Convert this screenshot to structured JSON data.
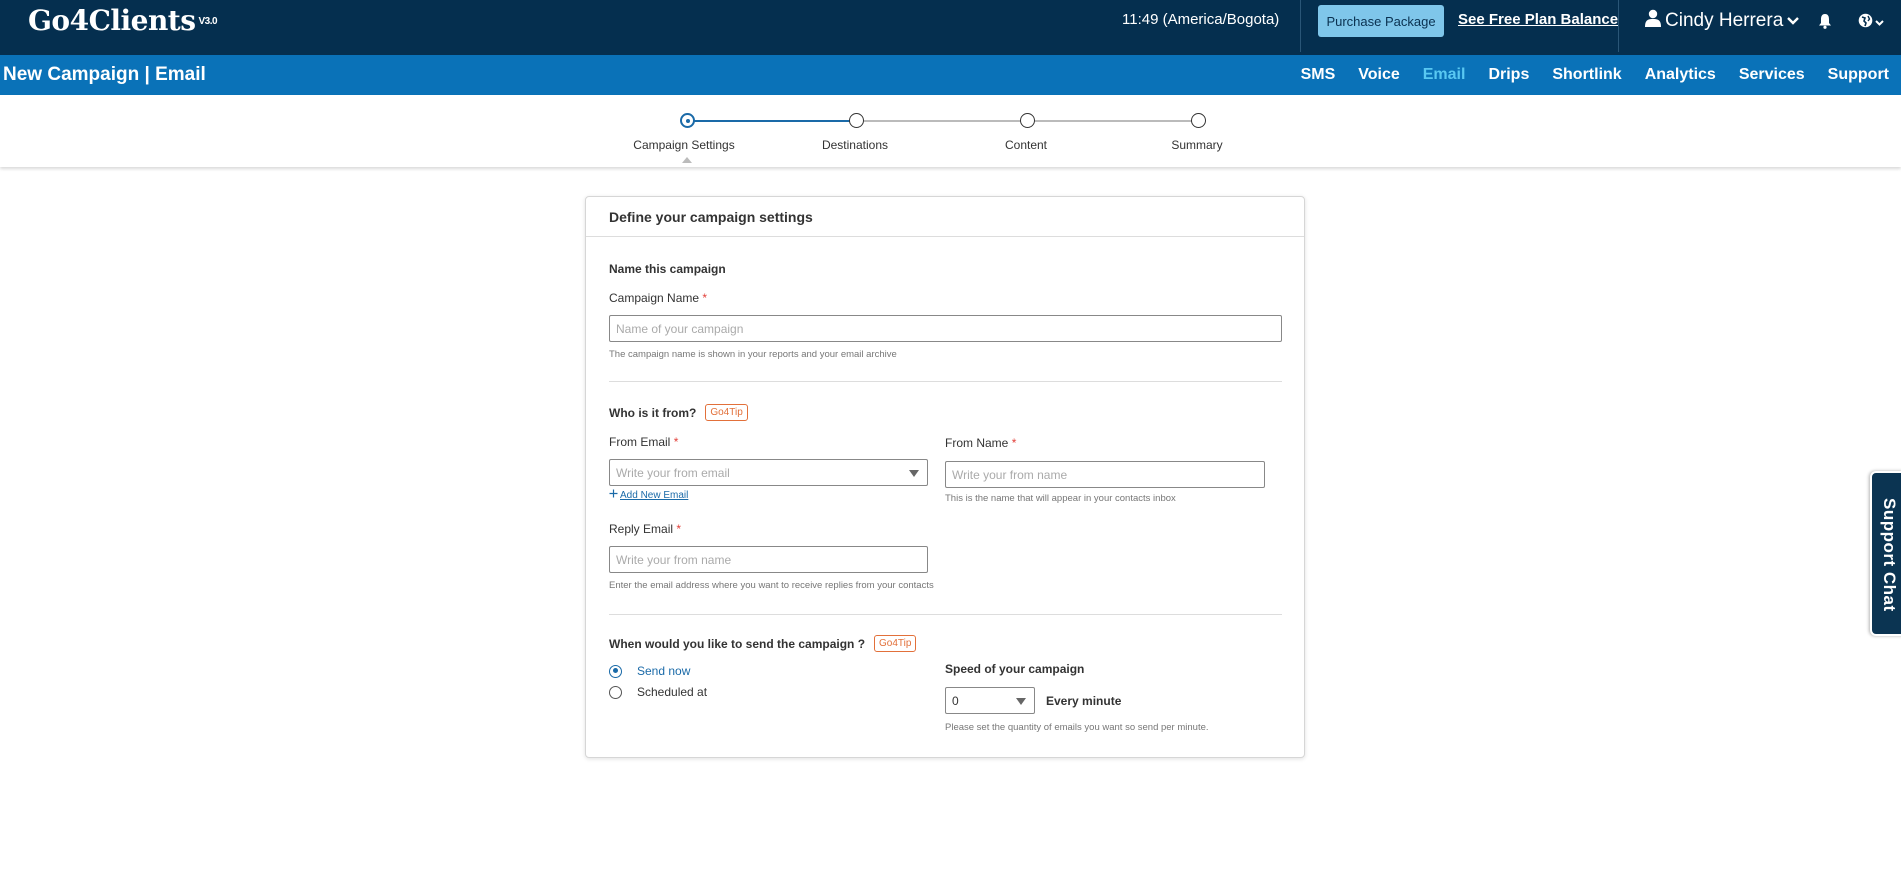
{
  "header": {
    "logo": "Go4Clients",
    "version": "V3.0",
    "clock": "11:49 (America/Bogota)",
    "purchase_label": "Purchase Package",
    "free_plan_label": "See Free Plan Balance",
    "user_name": "Cindy Herrera"
  },
  "subnav": {
    "page_title": "New Campaign | Email",
    "items": [
      "SMS",
      "Voice",
      "Email",
      "Drips",
      "Shortlink",
      "Analytics",
      "Services",
      "Support"
    ],
    "active": "Email"
  },
  "stepper": {
    "steps": [
      "Campaign Settings",
      "Destinations",
      "Content",
      "Summary"
    ],
    "current": 0
  },
  "form": {
    "card_title": "Define your campaign settings",
    "name_section": "Name this campaign",
    "campaign_name_label": "Campaign Name",
    "campaign_name_placeholder": "Name of your campaign",
    "campaign_name_help": "The campaign name is shown in your reports and your email archive",
    "from_section": "Who is it from?",
    "tip_label": "Go4Tip",
    "from_email_label": "From Email",
    "from_email_placeholder": "Write your from email",
    "add_email_label": "Add New Email",
    "from_name_label": "From Name",
    "from_name_placeholder": "Write your from name",
    "from_name_help": "This is the name that will appear in your contacts inbox",
    "reply_email_label": "Reply Email",
    "reply_email_placeholder": "Write your from name",
    "reply_email_help": "Enter the email address where you want to receive replies from your contacts",
    "send_section": "When would you like to send the campaign ?",
    "send_now_label": "Send now",
    "scheduled_label": "Scheduled at",
    "speed_label": "Speed of your campaign",
    "speed_value": "0",
    "speed_unit": "Every minute",
    "speed_help": "Please set the quantity of emails you want so send per minute."
  },
  "support_chat": {
    "label": "Support Chat"
  },
  "colors": {
    "topbar": "#052f4f",
    "subnav": "#0a72b8",
    "accent": "#1a6aa8",
    "nav_active": "#59c8f2",
    "tip": "#e2703a"
  }
}
